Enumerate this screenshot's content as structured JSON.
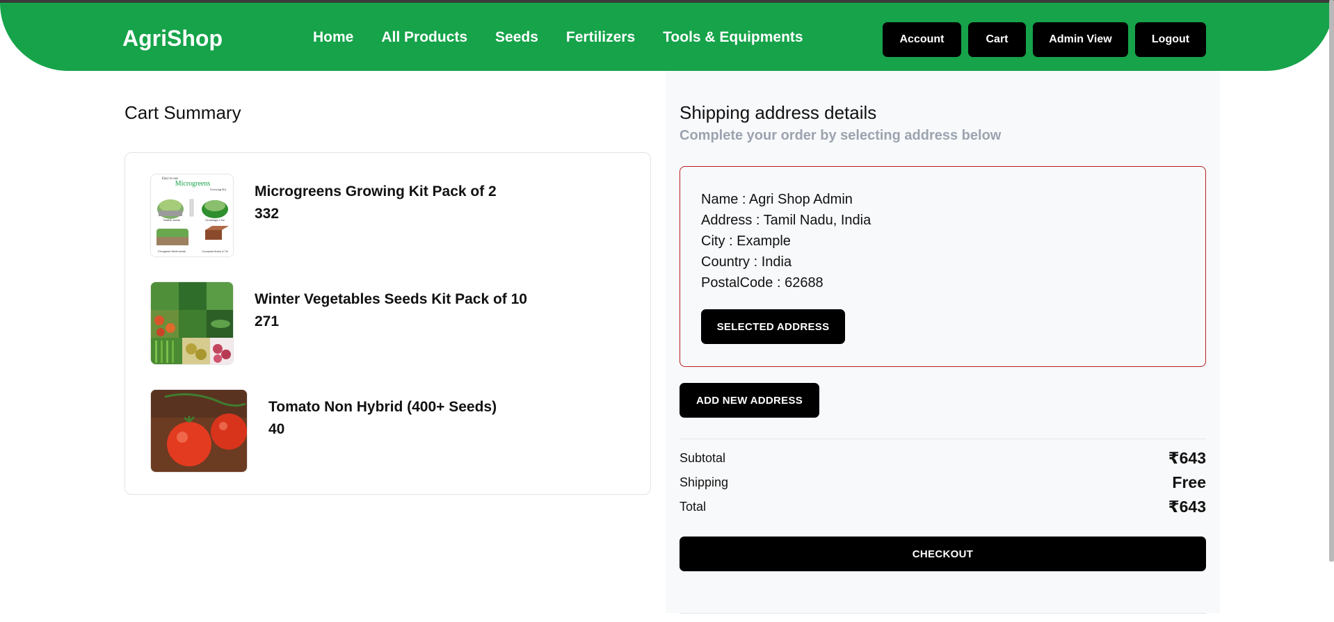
{
  "brand": "AgriShop",
  "nav": {
    "links": [
      "Home",
      "All Products",
      "Seeds",
      "Fertilizers",
      "Tools & Equipments"
    ],
    "actions": [
      "Account",
      "Cart",
      "Admin View",
      "Logout"
    ]
  },
  "cart": {
    "title": "Cart Summary",
    "items": [
      {
        "name": "Microgreens Growing Kit Pack of 2",
        "price": "332",
        "image": "microgreens-kit-image",
        "image_text": {
          "top": "Easy to use",
          "title": "Microgreens",
          "sub": "Growing Kit",
          "l1": "Radish seeds",
          "l2": "Growbags 2 No",
          "l3": "Fenugreek Methi seeds",
          "l4": "Cocopeat blocks & Tie"
        }
      },
      {
        "name": "Winter Vegetables Seeds Kit Pack of 10",
        "price": "271",
        "image": "winter-vegetables-image"
      },
      {
        "name": "Tomato Non Hybrid (400+ Seeds)",
        "price": "40",
        "image": "tomato-image"
      }
    ]
  },
  "shipping": {
    "title": "Shipping address details",
    "subtitle": "Complete your order by selecting address below",
    "address": {
      "name": "Name : Agri Shop Admin",
      "address": "Address : Tamil Nadu, India",
      "city": "City : Example",
      "country": "Country : India",
      "postal": "PostalCode : 62688"
    },
    "selected_label": "SELECTED ADDRESS",
    "add_new_label": "ADD NEW ADDRESS"
  },
  "summary": {
    "subtotal_label": "Subtotal",
    "subtotal": "₹643",
    "shipping_label": "Shipping",
    "shipping": "Free",
    "total_label": "Total",
    "total": "₹643"
  },
  "checkout_label": "CHECKOUT",
  "colors": {
    "brand_green": "#16a34a",
    "button_black": "#000000",
    "subtitle_gray": "#9ca3af",
    "address_border": "#b91c1c"
  }
}
